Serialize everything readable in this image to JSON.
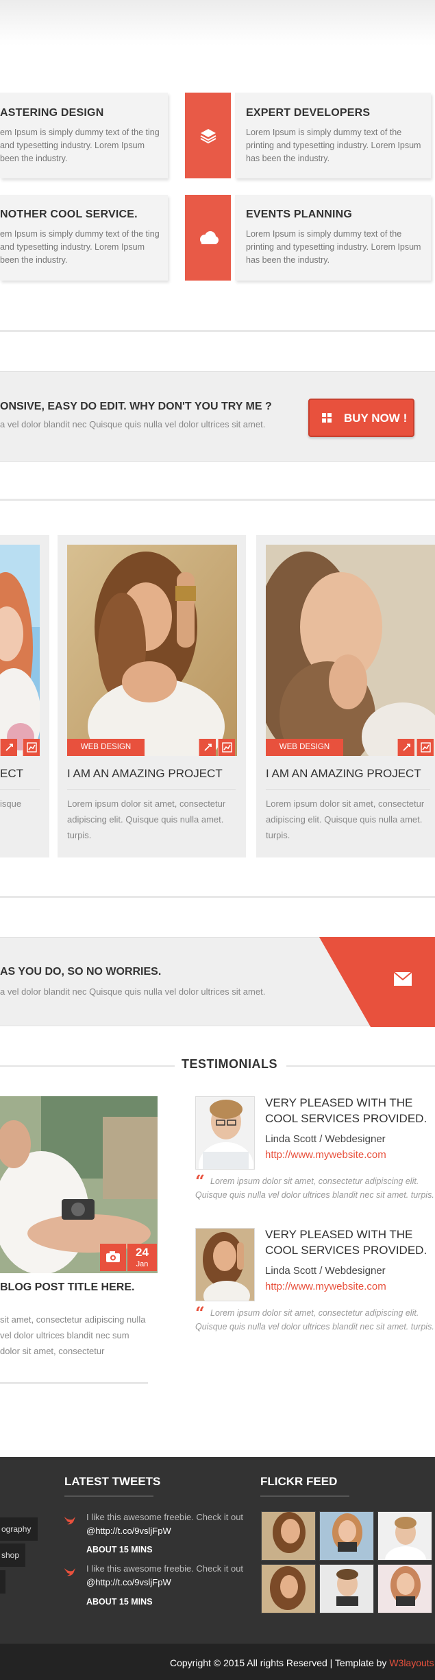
{
  "services": [
    {
      "title": "ASTERING DESIGN",
      "text": "em Ipsum is simply dummy text of the ting and typesetting industry. Lorem Ipsum been the industry.",
      "icon": "none"
    },
    {
      "title": "EXPERT DEVELOPERS",
      "text": "Lorem Ipsum is simply dummy text of the printing and typesetting industry. Lorem Ipsum has been the industry.",
      "icon": "layers-icon"
    },
    {
      "title": "NOTHER COOL SERVICE.",
      "text": "em Ipsum is simply dummy text of the ting and typesetting industry. Lorem Ipsum been the industry.",
      "icon": "none"
    },
    {
      "title": "EVENTS PLANNING",
      "text": "Lorem Ipsum is simply dummy text of the printing and typesetting industry. Lorem Ipsum has been the industry.",
      "icon": "cloud-icon"
    }
  ],
  "cta": {
    "headline": "ONSIVE, EASY DO EDIT. WHY DON'T YOU TRY ME ?",
    "subline": "a vel dolor blandit nec Quisque quis nulla vel dolor ultrices sit amet.",
    "button_label": "BUY NOW !"
  },
  "portfolio": [
    {
      "tag": "",
      "title": "ECT",
      "text": "isque"
    },
    {
      "tag": "WEB DESIGN",
      "title": "I AM AN AMAZING PROJECT",
      "text": "Lorem ipsum dolor sit amet, consectetur adipiscing elit. Quisque quis nulla amet. turpis."
    },
    {
      "tag": "WEB DESIGN",
      "title": "I AM AN AMAZING PROJECT",
      "text": "Lorem ipsum dolor sit amet, consectetur adipiscing elit. Quisque quis nulla amet. turpis."
    }
  ],
  "contact": {
    "headline": "AS YOU DO, SO NO WORRIES.",
    "subline": "a vel dolor blandit nec Quisque quis nulla vel dolor ultrices sit amet."
  },
  "testimonials_section": {
    "title": "TESTIMONIALS",
    "blog": {
      "day": "24",
      "month": "Jan",
      "title": "BLOG POST TITLE HERE.",
      "text": "sit amet, consectetur adipiscing nulla vel dolor ultrices blandit nec sum dolor sit amet, consectetur"
    },
    "items": [
      {
        "headline": "VERY PLEASED WITH THE COOL SERVICES PROVIDED.",
        "name": "Linda Scott / Webdesigner",
        "link": "http://www.mywebsite.com",
        "quote": "Lorem ipsum dolor sit amet, consectetur adipiscing elit. Quisque quis nulla vel dolor ultrices blandit nec sit amet. turpis."
      },
      {
        "headline": "VERY PLEASED WITH THE COOL SERVICES PROVIDED.",
        "name": "Linda Scott / Webdesigner",
        "link": "http://www.mywebsite.com",
        "quote": "Lorem ipsum dolor sit amet, consectetur adipiscing elit. Quisque quis nulla vel dolor ultrices blandit nec sit amet. turpis."
      }
    ]
  },
  "footer": {
    "tags": [
      "ography",
      "shop",
      ""
    ],
    "tweets_title": "LATEST TWEETS",
    "tweets": [
      {
        "text_a": "I like this awesome freebie. Check it out",
        "handle": "@http://t.co/9vsljFpW",
        "time": "ABOUT 15 MINS"
      },
      {
        "text_a": "I like this awesome freebie. Check it out",
        "handle": "@http://t.co/9vsljFpW",
        "time": "ABOUT 15 MINS"
      }
    ],
    "flickr_title": "FLICKR FEED",
    "copyright": "Copyright © 2015 All rights Reserved | Template by",
    "brand": "W3layouts"
  },
  "colors": {
    "accent": "#e8513d",
    "footer_bg": "#333333",
    "band_bg": "#efefef"
  }
}
